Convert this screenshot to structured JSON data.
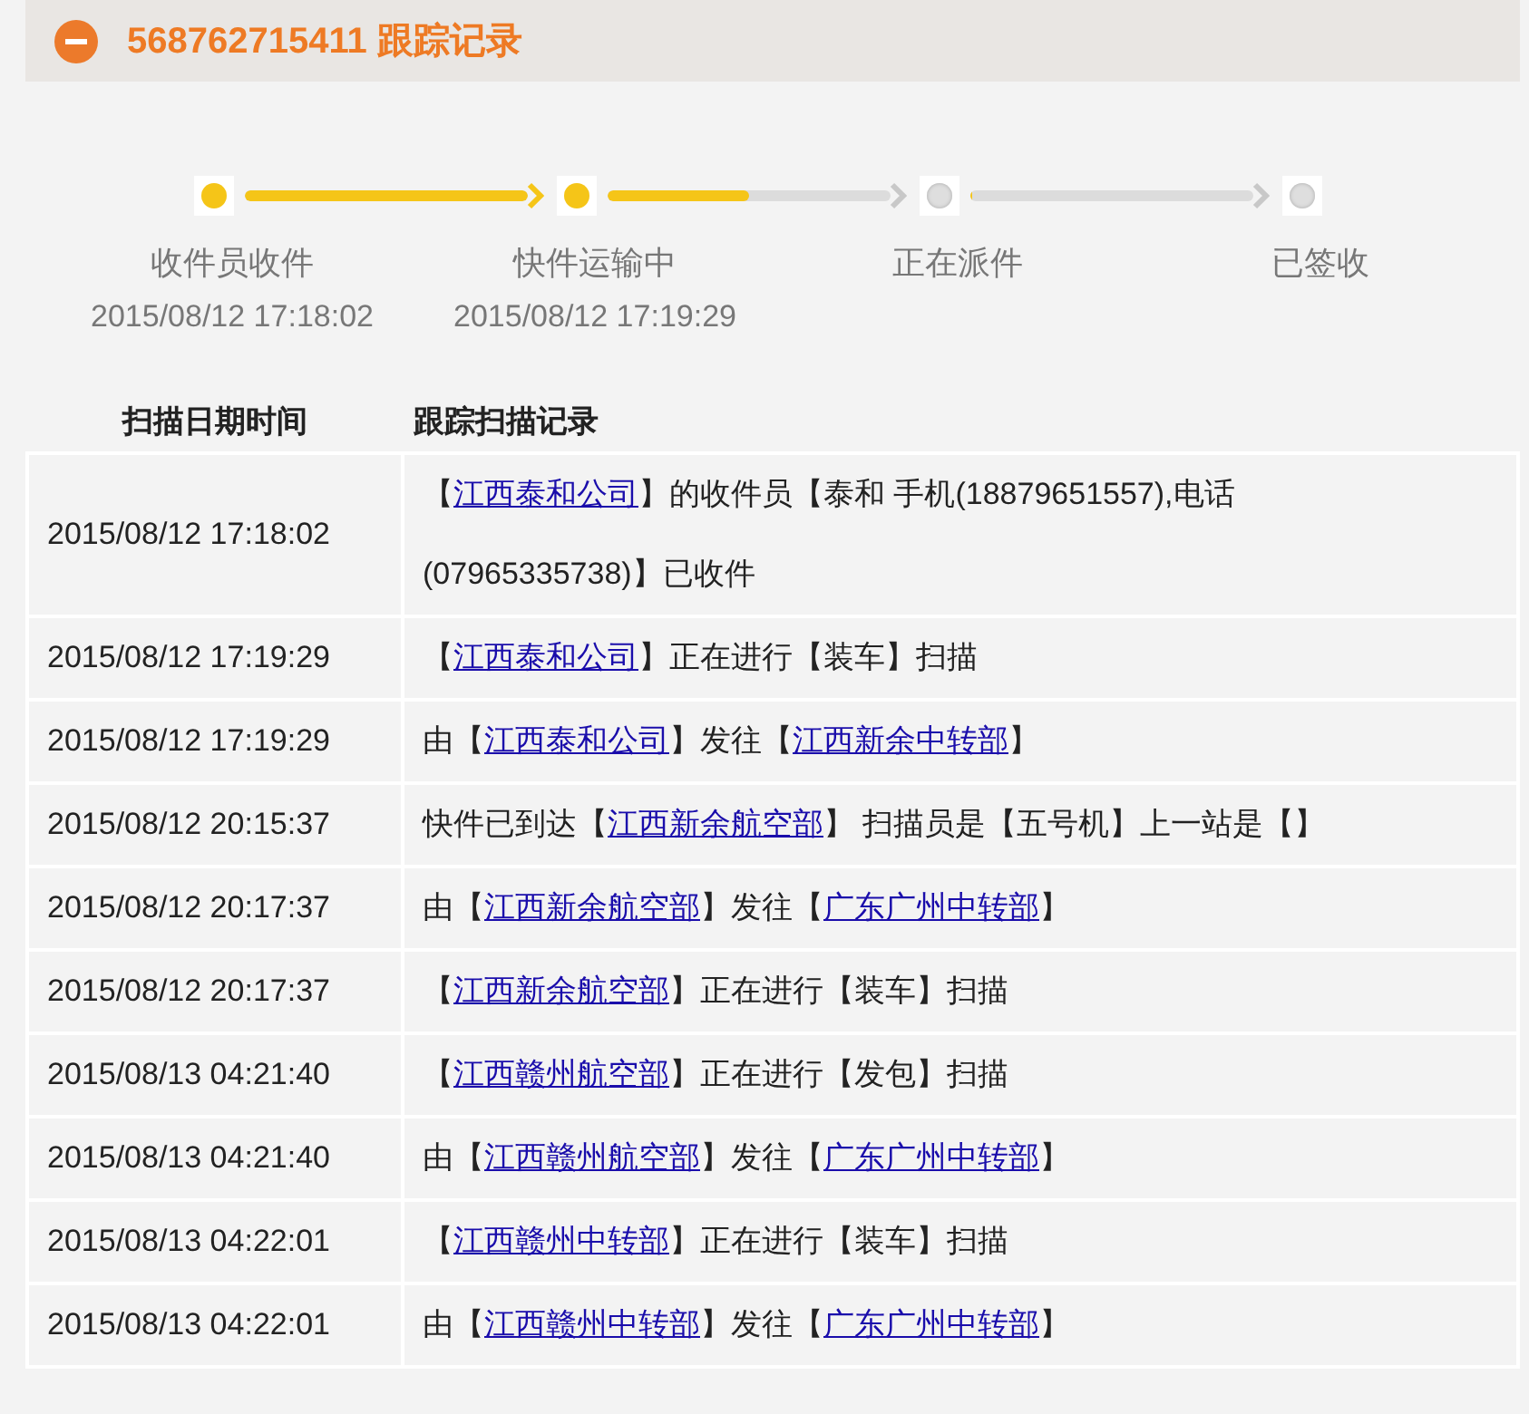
{
  "header": {
    "title": "568762715411 跟踪记录",
    "expanded": true
  },
  "progress": {
    "steps": [
      {
        "label": "收件员收件",
        "time": "2015/08/12 17:18:02",
        "done": true,
        "level": 1
      },
      {
        "label": "快件运输中",
        "time": "2015/08/12 17:19:29",
        "done": true,
        "level": 0.5
      },
      {
        "label": "正在派件",
        "done": false,
        "level": 0
      },
      {
        "label": "已签收",
        "done": false
      }
    ]
  },
  "table": {
    "columns": [
      "扫描日期时间",
      "跟踪扫描记录"
    ],
    "rows": [
      {
        "time": "2015/08/12 17:18:02",
        "record": [
          {
            "kind": "text",
            "text": "【"
          },
          {
            "kind": "link",
            "text": "江西泰和公司"
          },
          {
            "kind": "text",
            "text": "】的收件员【泰和 手机(18879651557),电话(07965335738)】已收件"
          }
        ]
      },
      {
        "time": "2015/08/12 17:19:29",
        "record": [
          {
            "kind": "text",
            "text": "【"
          },
          {
            "kind": "link",
            "text": "江西泰和公司"
          },
          {
            "kind": "text",
            "text": "】正在进行【装车】扫描"
          }
        ]
      },
      {
        "time": "2015/08/12 17:19:29",
        "record": [
          {
            "kind": "text",
            "text": "由【"
          },
          {
            "kind": "link",
            "text": "江西泰和公司"
          },
          {
            "kind": "text",
            "text": "】发往【"
          },
          {
            "kind": "link",
            "text": "江西新余中转部"
          },
          {
            "kind": "text",
            "text": "】"
          }
        ]
      },
      {
        "time": "2015/08/12 20:15:37",
        "record": [
          {
            "kind": "text",
            "text": "快件已到达【"
          },
          {
            "kind": "link",
            "text": "江西新余航空部"
          },
          {
            "kind": "text",
            "text": "】 扫描员是【五号机】上一站是【】"
          }
        ]
      },
      {
        "time": "2015/08/12 20:17:37",
        "record": [
          {
            "kind": "text",
            "text": "由【"
          },
          {
            "kind": "link",
            "text": "江西新余航空部"
          },
          {
            "kind": "text",
            "text": "】发往【"
          },
          {
            "kind": "link",
            "text": "广东广州中转部"
          },
          {
            "kind": "text",
            "text": "】"
          }
        ]
      },
      {
        "time": "2015/08/12 20:17:37",
        "record": [
          {
            "kind": "text",
            "text": "【"
          },
          {
            "kind": "link",
            "text": "江西新余航空部"
          },
          {
            "kind": "text",
            "text": "】正在进行【装车】扫描"
          }
        ]
      },
      {
        "time": "2015/08/13 04:21:40",
        "record": [
          {
            "kind": "text",
            "text": "【"
          },
          {
            "kind": "link",
            "text": "江西赣州航空部"
          },
          {
            "kind": "text",
            "text": "】正在进行【发包】扫描"
          }
        ]
      },
      {
        "time": "2015/08/13 04:21:40",
        "record": [
          {
            "kind": "text",
            "text": "由【"
          },
          {
            "kind": "link",
            "text": "江西赣州航空部"
          },
          {
            "kind": "text",
            "text": "】发往【"
          },
          {
            "kind": "link",
            "text": "广东广州中转部"
          },
          {
            "kind": "text",
            "text": "】"
          }
        ]
      },
      {
        "time": "2015/08/13 04:22:01",
        "record": [
          {
            "kind": "text",
            "text": "【"
          },
          {
            "kind": "link",
            "text": "江西赣州中转部"
          },
          {
            "kind": "text",
            "text": "】正在进行【装车】扫描"
          }
        ]
      },
      {
        "time": "2015/08/13 04:22:01",
        "record": [
          {
            "kind": "text",
            "text": "由【"
          },
          {
            "kind": "link",
            "text": "江西赣州中转部"
          },
          {
            "kind": "text",
            "text": "】发往【"
          },
          {
            "kind": "link",
            "text": "广东广州中转部"
          },
          {
            "kind": "text",
            "text": "】"
          }
        ]
      }
    ]
  }
}
